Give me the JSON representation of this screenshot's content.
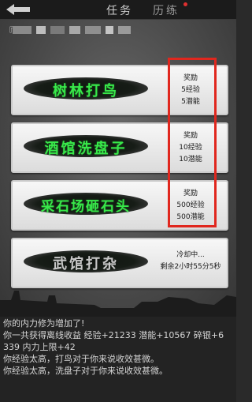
{
  "header": {
    "tabs": [
      {
        "label": "任务",
        "active": true
      },
      {
        "label": "历练",
        "active": false,
        "has_notification": true
      }
    ]
  },
  "player": {
    "prefix": "『"
  },
  "tasks": [
    {
      "name": "树林打鸟",
      "info_line1": "奖励",
      "info_line2": "5经验",
      "info_line3": "5潜能",
      "available": true
    },
    {
      "name": "酒馆洗盘子",
      "info_line1": "奖励",
      "info_line2": "10经验",
      "info_line3": "10潜能",
      "available": true
    },
    {
      "name": "采石场砸石头",
      "info_line1": "奖励",
      "info_line2": "500经验",
      "info_line3": "500潜能",
      "available": true
    },
    {
      "name": "武馆打杂",
      "info_line1": "冷却中...",
      "info_line2": "剩余2小时55分5秒",
      "info_line3": "",
      "available": false
    }
  ],
  "log": [
    "你的内力修为增加了!",
    "你一共获得离线收益 经验+21233 潜能+10567 碎银+6",
    "339 内力上限+42",
    "你经验太高，打鸟对于你来说收效甚微。",
    "你经验太高，洗盘子对于你来说收效甚微。"
  ],
  "colors": {
    "task_name_active": "#38e84a",
    "highlight_frame": "#e0271e",
    "notification_dot": "#e03030"
  }
}
